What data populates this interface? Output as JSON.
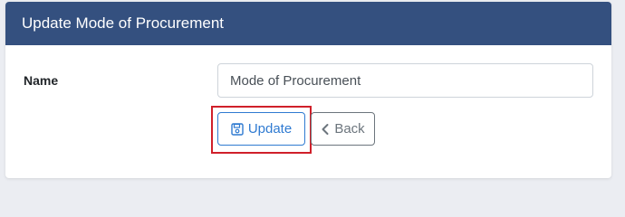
{
  "header": {
    "title": "Update Mode of Procurement"
  },
  "form": {
    "name_label": "Name",
    "name_value": "Mode of Procurement"
  },
  "actions": {
    "update_label": "Update",
    "update_icon": "floppy-disk-icon",
    "back_label": "Back",
    "back_icon": "chevron-left-icon"
  },
  "colors": {
    "header_bg": "#34507f",
    "primary": "#2f7ad1",
    "secondary": "#6c757d",
    "highlight": "#d0202a"
  }
}
